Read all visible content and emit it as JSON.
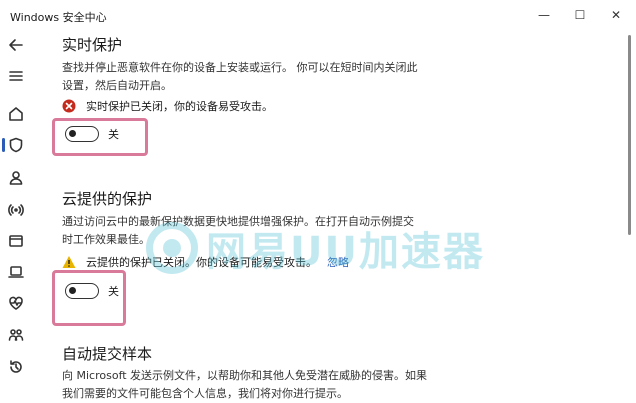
{
  "window": {
    "title": "Windows 安全中心",
    "minimize_glyph": "—",
    "maximize_glyph": "☐",
    "close_glyph": "✕"
  },
  "sidebar": {
    "items": [
      {
        "name": "back",
        "icon": "back-arrow-icon"
      },
      {
        "name": "menu",
        "icon": "hamburger-menu-icon"
      },
      {
        "name": "home",
        "icon": "home-icon"
      },
      {
        "name": "virus-protection",
        "icon": "shield-icon",
        "active": true
      },
      {
        "name": "account",
        "icon": "person-icon"
      },
      {
        "name": "firewall",
        "icon": "wifi-signal-icon"
      },
      {
        "name": "app-browser",
        "icon": "browser-window-icon"
      },
      {
        "name": "device-security",
        "icon": "laptop-icon"
      },
      {
        "name": "device-health",
        "icon": "heart-pulse-icon"
      },
      {
        "name": "family",
        "icon": "family-icon"
      },
      {
        "name": "history",
        "icon": "history-icon"
      }
    ]
  },
  "sections": {
    "realtime": {
      "title": "实时保护",
      "desc_line1": "查找并停止恶意软件在你的设备上安装或运行。 你可以在短时间内关闭此",
      "desc_line2": "设置，然后自动开启。",
      "status": "实时保护已关闭，你的设备易受攻击。",
      "status_color": "#c42b1c",
      "toggle_label": "关",
      "toggle_on": false
    },
    "cloud": {
      "title": "云提供的保护",
      "desc_line1": "通过访问云中的最新保护数据更快地提供增强保护。在打开自动示例提交",
      "desc_line2": "时工作效果最佳。",
      "status": "云提供的保护已关闭。你的设备可能易受攻击。",
      "status_color": "#e8b400",
      "ignore_label": "忽略",
      "toggle_label": "关",
      "toggle_on": false
    },
    "sample": {
      "title": "自动提交样本",
      "desc_line1": "向 Microsoft 发送示例文件，以帮助你和其他人免受潜在威胁的侵害。如果",
      "desc_line2": "我们需要的文件可能包含个人信息，我们将对你进行提示。"
    }
  },
  "watermark": {
    "text": "网易UU加速器",
    "color": "#56c3d6"
  },
  "highlight_color": "#d97a9a",
  "accent_color": "#2b5db8"
}
